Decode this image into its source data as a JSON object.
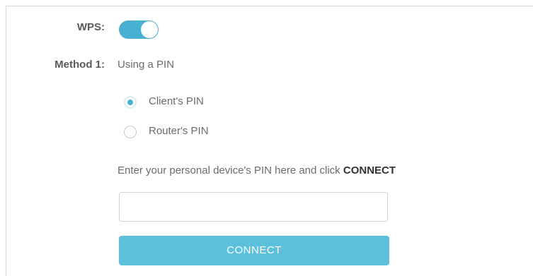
{
  "wps": {
    "label": "WPS:",
    "enabled": true,
    "toggle_color": "#4ab0d2"
  },
  "method1": {
    "label": "Method 1:",
    "value": "Using a PIN",
    "options": [
      {
        "label": "Client's PIN",
        "selected": true
      },
      {
        "label": "Router's PIN",
        "selected": false
      }
    ],
    "instruction_prefix": "Enter your personal device's PIN here and click ",
    "instruction_action": "CONNECT",
    "pin_value": "",
    "connect_label": "CONNECT",
    "button_color": "#5cc0dc"
  }
}
